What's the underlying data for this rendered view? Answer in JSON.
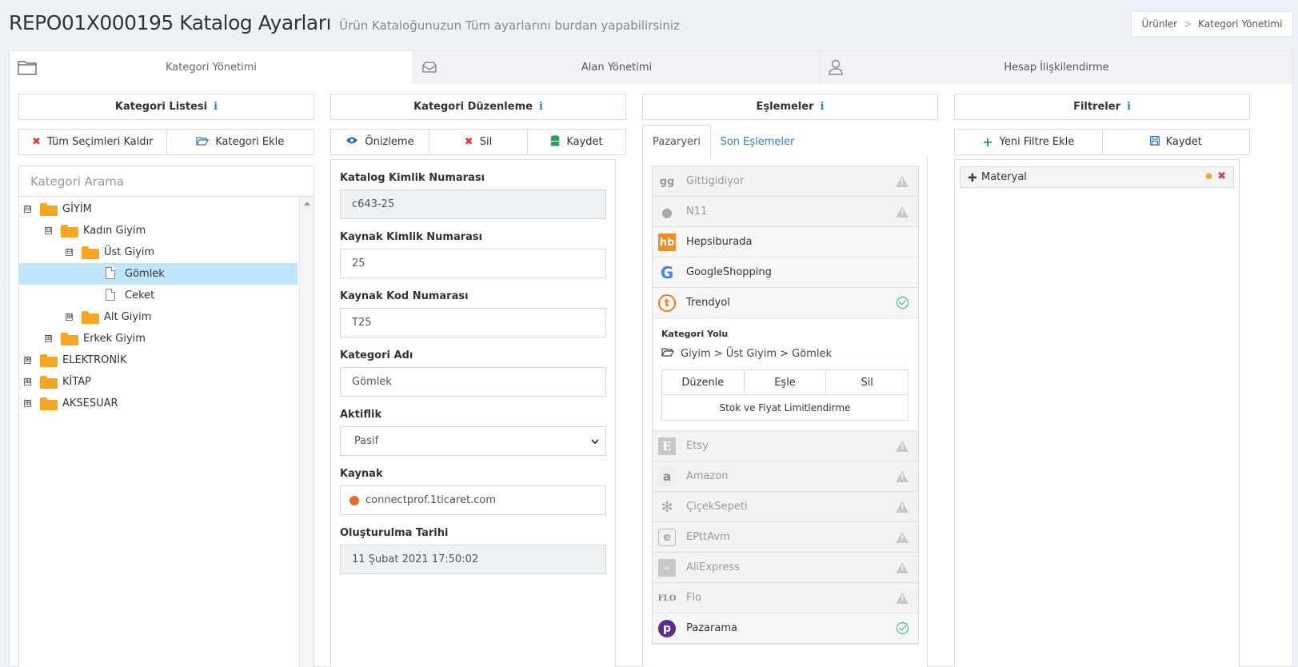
{
  "header": {
    "title": "REPO01X000195 Katalog Ayarları",
    "subtitle": "Ürün Kataloğunuzun Tüm ayarlarını burdan yapabilirsiniz"
  },
  "breadcrumb": {
    "items": [
      "Ürünler",
      "Kategori Yönetimi"
    ],
    "separator": ">"
  },
  "tabs": [
    {
      "label": "Kategori Yönetimi",
      "icon": "folder-icon",
      "active": true
    },
    {
      "label": "Alan Yönetimi",
      "icon": "envelope-icon",
      "active": false
    },
    {
      "label": "Hesap İlişkilendirme",
      "icon": "user-icon",
      "active": false
    }
  ],
  "category_list": {
    "title": "Kategori Listesi",
    "clear_label": "Tüm Seçimleri Kaldır",
    "add_label": "Kategori Ekle",
    "search_placeholder": "Kategori Arama",
    "tree": [
      {
        "label": "GİYİM",
        "toggle": "⊟",
        "type": "folder"
      },
      {
        "label": "Kadın Giyim",
        "toggle": "⊟",
        "type": "folder"
      },
      {
        "label": "Üst Giyim",
        "toggle": "⊟",
        "type": "folder"
      },
      {
        "label": "Gömlek",
        "toggle": "",
        "type": "file",
        "selected": true
      },
      {
        "label": "Ceket",
        "toggle": "",
        "type": "file"
      },
      {
        "label": "Alt Giyim",
        "toggle": "⊞",
        "type": "folder"
      },
      {
        "label": "Erkek Giyim",
        "toggle": "⊞",
        "type": "folder"
      },
      {
        "label": "ELEKTRONİK",
        "toggle": "⊞",
        "type": "folder"
      },
      {
        "label": "KİTAP",
        "toggle": "⊞",
        "type": "folder"
      },
      {
        "label": "AKSESUAR",
        "toggle": "⊞",
        "type": "folder"
      }
    ]
  },
  "category_edit": {
    "title": "Kategori Düzenleme",
    "preview_label": "Önizleme",
    "delete_label": "Sil",
    "save_label": "Kaydet",
    "fields": {
      "catalog_id_label": "Katalog Kimlik Numarası",
      "catalog_id_value": "c643-25",
      "source_id_label": "Kaynak Kimlik Numarası",
      "source_id_value": "25",
      "source_code_label": "Kaynak Kod Numarası",
      "source_code_value": "T25",
      "name_label": "Kategori Adı",
      "name_value": "Gömlek",
      "active_label": "Aktiflik",
      "active_value": "Pasif",
      "source_label": "Kaynak",
      "source_value": "connectprof.1ticaret.com",
      "created_label": "Oluşturulma Tarihi",
      "created_value": "11 Şubat 2021 17:50:02"
    }
  },
  "mappings": {
    "title": "Eşlemeler",
    "tab_marketplace": "Pazaryeri",
    "tab_recent": "Son Eşlemeler",
    "marketplaces_top": [
      {
        "name": "Gittigidiyor",
        "logo": "gg",
        "status": "warning",
        "enabled": false,
        "color": "#999999"
      },
      {
        "name": "N11",
        "logo": "●",
        "status": "warning",
        "enabled": false,
        "color": "#999999"
      },
      {
        "name": "Hepsiburada",
        "logo": "hb",
        "status": "none",
        "enabled": true,
        "color": "#f28b20"
      },
      {
        "name": "GoogleShopping",
        "logo": "G",
        "status": "none",
        "enabled": true,
        "color": "#4285f4"
      },
      {
        "name": "Trendyol",
        "logo": "t",
        "status": "ok",
        "enabled": true,
        "color": "#f27a1a"
      }
    ],
    "expanded": {
      "label": "Kategori Yolu",
      "path": "Giyim > Üst Giyim > Gömlek",
      "edit_label": "Düzenle",
      "map_label": "Eşle",
      "delete_label": "Sil",
      "limit_label": "Stok ve Fiyat Limitlendirme"
    },
    "marketplaces_bottom": [
      {
        "name": "Etsy",
        "logo": "E",
        "status": "warning",
        "enabled": false,
        "color": "#999999"
      },
      {
        "name": "Amazon",
        "logo": "a",
        "status": "warning",
        "enabled": false,
        "color": "#999999"
      },
      {
        "name": "ÇiçekSepeti",
        "logo": "✻",
        "status": "warning",
        "enabled": false,
        "color": "#999999"
      },
      {
        "name": "EPttAvm",
        "logo": "e",
        "status": "warning",
        "enabled": false,
        "color": "#999999"
      },
      {
        "name": "AliExpress",
        "logo": "▬",
        "status": "warning",
        "enabled": false,
        "color": "#999999"
      },
      {
        "name": "Flo",
        "logo": "FLO",
        "status": "warning",
        "enabled": false,
        "color": "#999999"
      },
      {
        "name": "Pazarama",
        "logo": "p",
        "status": "ok",
        "enabled": true,
        "color": "#5a2d91"
      }
    ]
  },
  "filters": {
    "title": "Filtreler",
    "add_label": "Yeni Filtre Ekle",
    "save_label": "Kaydet",
    "items": [
      {
        "label": "Materyal"
      }
    ]
  }
}
